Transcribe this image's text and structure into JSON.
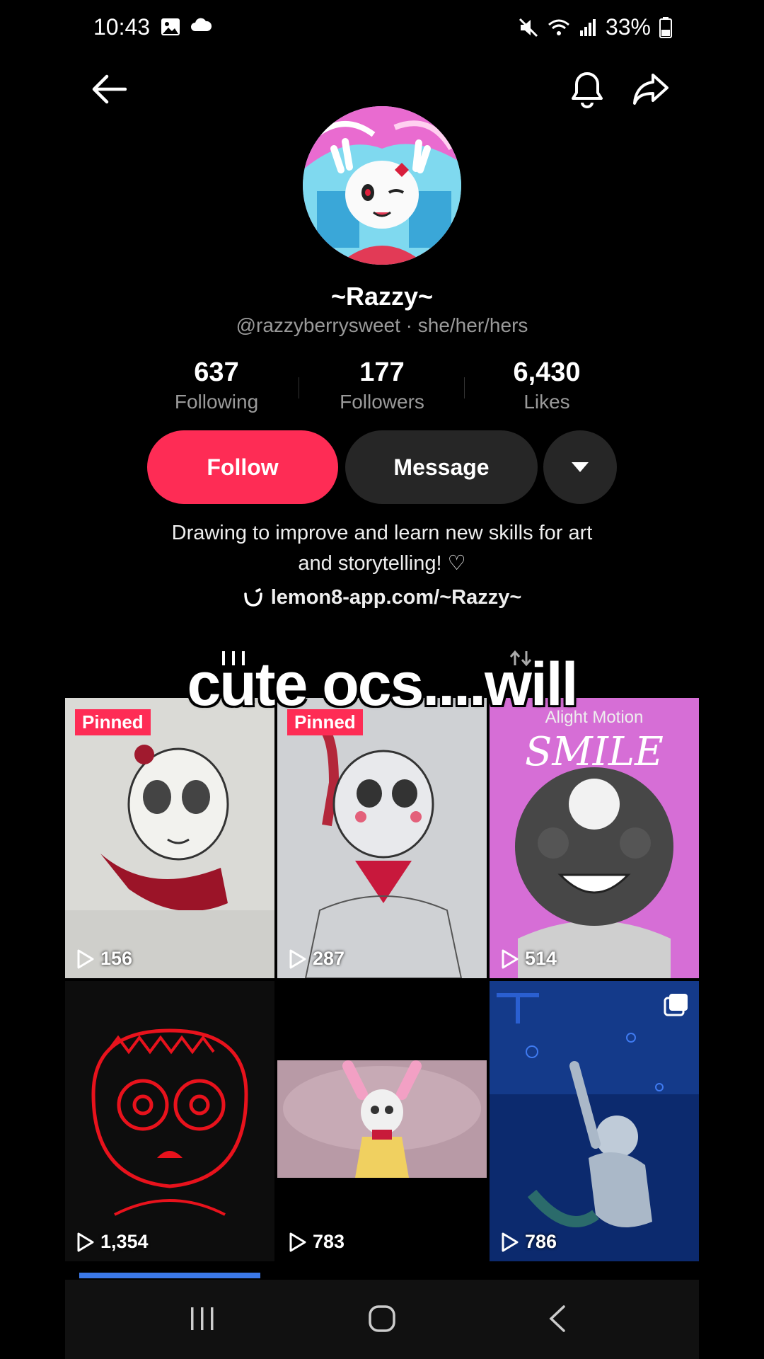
{
  "status_bar": {
    "time": "10:43",
    "battery": "33%"
  },
  "profile": {
    "display_name": "~Razzy~",
    "handle_line": "@razzyberrysweet · she/her/hers",
    "stats": [
      {
        "value": "637",
        "label": "Following"
      },
      {
        "value": "177",
        "label": "Followers"
      },
      {
        "value": "6,430",
        "label": "Likes"
      }
    ],
    "follow_label": "Follow",
    "message_label": "Message",
    "bio_line1": "Drawing to improve and learn new skills for art",
    "bio_line2": "and storytelling! ♡",
    "link": "lemon8-app.com/~Razzy~"
  },
  "caption": "cute ocs....will",
  "videos": [
    {
      "pinned": "Pinned",
      "views": "156"
    },
    {
      "pinned": "Pinned",
      "views": "287"
    },
    {
      "watermark": "Alight Motion",
      "title": "SMILE",
      "views": "514"
    },
    {
      "views": "1,354"
    },
    {
      "views": "783"
    },
    {
      "views": "786"
    }
  ],
  "colors": {
    "accent": "#fe2c55",
    "button_dark": "#262626",
    "muted_text": "#9a9a9a"
  }
}
